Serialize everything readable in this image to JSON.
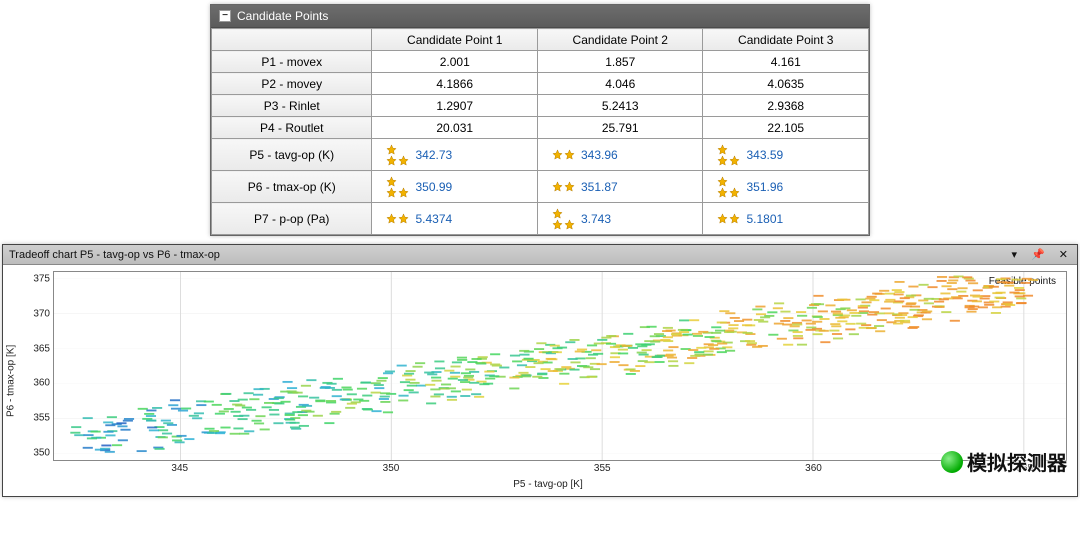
{
  "table": {
    "title": "Candidate Points",
    "columns": [
      "Candidate Point 1",
      "Candidate Point 2",
      "Candidate Point 3"
    ],
    "rows": [
      {
        "label": "P1 - movex",
        "starred": false,
        "values": [
          "2.001",
          "1.857",
          "4.161"
        ]
      },
      {
        "label": "P2 - movey",
        "starred": false,
        "values": [
          "4.1866",
          "4.046",
          "4.0635"
        ]
      },
      {
        "label": "P3 - Rinlet",
        "starred": false,
        "values": [
          "1.2907",
          "5.2413",
          "2.9368"
        ]
      },
      {
        "label": "P4 - Routlet",
        "starred": false,
        "values": [
          "20.031",
          "25.791",
          "22.105"
        ]
      },
      {
        "label": "P5 - tavg-op (K)",
        "starred": true,
        "stars": [
          3,
          2,
          3
        ],
        "values": [
          "342.73",
          "343.96",
          "343.59"
        ]
      },
      {
        "label": "P6 - tmax-op (K)",
        "starred": true,
        "stars": [
          3,
          2,
          3
        ],
        "values": [
          "350.99",
          "351.87",
          "351.96"
        ]
      },
      {
        "label": "P7 - p-op (Pa)",
        "starred": true,
        "stars": [
          2,
          3,
          2
        ],
        "values": [
          "5.4374",
          "3.743",
          "5.1801"
        ]
      }
    ]
  },
  "chart": {
    "title": "Tradeoff chart P5 - tavg-op vs P6 - tmax-op",
    "xlabel": "P5 - tavg-op  [K]",
    "ylabel": "P6 - tmax-op  [K]",
    "annotation": "Feasible points",
    "xticks": [
      345,
      350,
      355,
      360,
      365
    ],
    "yticks": [
      350,
      355,
      360,
      365,
      370,
      375
    ],
    "xlim": [
      342,
      366
    ],
    "ylim": [
      349,
      376
    ],
    "watermark": "模拟探测器",
    "window_buttons": {
      "dropdown": "▾",
      "pin": "📌",
      "close": "✕"
    }
  },
  "chart_data": {
    "type": "scatter",
    "title": "Tradeoff chart P5 - tavg-op vs P6 - tmax-op",
    "xlabel": "P5 - tavg-op  [K]",
    "ylabel": "P6 - tmax-op  [K]",
    "xlim": [
      342,
      366
    ],
    "ylim": [
      349,
      376
    ],
    "n_points_approx": 700,
    "note": "Dense scatter cloud roughly following y ≈ x + 9 (i.e. tmax ≈ tavg + 9 K), spread ±2–3 K. Color appears to encode a third parameter: low x/y region mostly blue, mid region green/yellow, high region orange/yellow. Annotation 'Feasible points' sits near the upper-right corner.",
    "trend_samples": [
      {
        "x": 342.5,
        "y": 351.0
      },
      {
        "x": 343.0,
        "y": 351.5
      },
      {
        "x": 343.5,
        "y": 352.0
      },
      {
        "x": 344.0,
        "y": 352.5
      },
      {
        "x": 345.0,
        "y": 354.0
      },
      {
        "x": 346.0,
        "y": 355.0
      },
      {
        "x": 347.0,
        "y": 356.0
      },
      {
        "x": 348.0,
        "y": 357.0
      },
      {
        "x": 349.0,
        "y": 358.0
      },
      {
        "x": 350.0,
        "y": 359.0
      },
      {
        "x": 351.0,
        "y": 360.0
      },
      {
        "x": 352.0,
        "y": 361.0
      },
      {
        "x": 353.0,
        "y": 362.0
      },
      {
        "x": 354.0,
        "y": 363.0
      },
      {
        "x": 355.0,
        "y": 364.0
      },
      {
        "x": 356.0,
        "y": 365.0
      },
      {
        "x": 357.0,
        "y": 366.0
      },
      {
        "x": 358.0,
        "y": 367.0
      },
      {
        "x": 359.0,
        "y": 368.0
      },
      {
        "x": 360.0,
        "y": 369.0
      },
      {
        "x": 361.0,
        "y": 370.0
      },
      {
        "x": 362.0,
        "y": 371.0
      },
      {
        "x": 363.0,
        "y": 372.0
      },
      {
        "x": 364.0,
        "y": 373.0
      },
      {
        "x": 365.0,
        "y": 374.0
      }
    ],
    "color_stops": [
      {
        "t": 0.0,
        "hex": "#1f4fbf"
      },
      {
        "t": 0.25,
        "hex": "#2fb1d6"
      },
      {
        "t": 0.5,
        "hex": "#3fd65f"
      },
      {
        "t": 0.75,
        "hex": "#e8d23a"
      },
      {
        "t": 1.0,
        "hex": "#f08a2a"
      }
    ]
  }
}
